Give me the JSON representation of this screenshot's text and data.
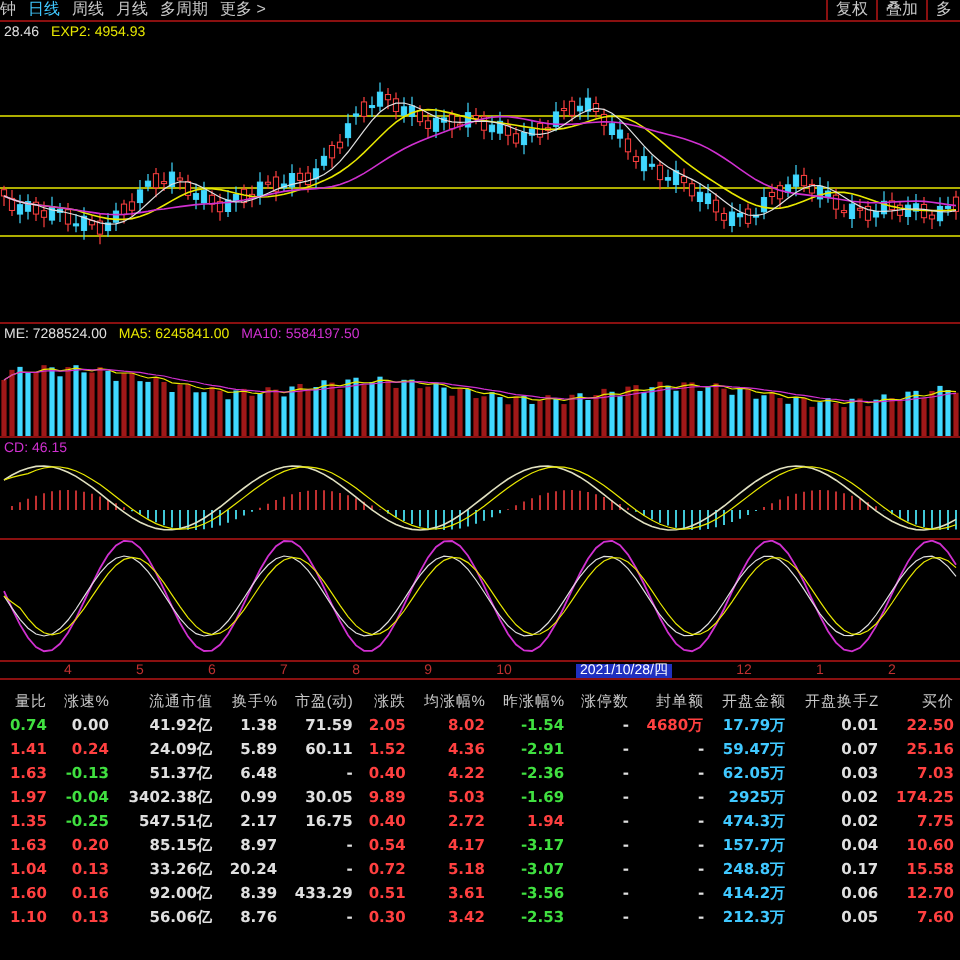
{
  "toolbar": {
    "periods": [
      {
        "label": "钟",
        "selected": false
      },
      {
        "label": "日线",
        "selected": true
      },
      {
        "label": "周线",
        "selected": false
      },
      {
        "label": "月线",
        "selected": false
      },
      {
        "label": "多周期",
        "selected": false
      },
      {
        "label": "更多 >",
        "selected": false
      }
    ],
    "actions": [
      "复权",
      "叠加",
      "多"
    ]
  },
  "main_legend": [
    {
      "text": "28.46",
      "color": "#e0e0e0"
    },
    {
      "text": "EXP2: 4954.93",
      "color": "#e8e800"
    }
  ],
  "volume_legend": [
    {
      "text": "ME: 7288524.00",
      "color": "#e0e0e0"
    },
    {
      "text": "MA5: 6245841.00",
      "color": "#e8e800"
    },
    {
      "text": "MA10: 5584197.50",
      "color": "#d030d0"
    }
  ],
  "macd_legend": [
    {
      "text": "CD: 46.15",
      "color": "#d030d0"
    }
  ],
  "axis_labels": [
    {
      "label": "4",
      "selected": false
    },
    {
      "label": "5",
      "selected": false
    },
    {
      "label": "6",
      "selected": false
    },
    {
      "label": "7",
      "selected": false
    },
    {
      "label": "8",
      "selected": false
    },
    {
      "label": "9",
      "selected": false
    },
    {
      "label": "10",
      "selected": false
    },
    {
      "label": "2021/10/28/四",
      "selected": true
    },
    {
      "label": "12",
      "selected": false
    },
    {
      "label": "1",
      "selected": false
    },
    {
      "label": "2",
      "selected": false
    }
  ],
  "table": {
    "columns": [
      "量比",
      "涨速%",
      "流通市值",
      "换手%",
      "市盈(动)",
      "涨跌",
      "均涨幅%",
      "昨涨幅%",
      "涨停数",
      "封单额",
      "开盘金额",
      "开盘换手Z",
      "买价"
    ],
    "rows": [
      {
        "cells": [
          {
            "text": "0.74",
            "color": "#40e040"
          },
          {
            "text": "0.00",
            "color": "#e0e0e0"
          },
          {
            "text": "41.92亿",
            "color": "#e0e0e0"
          },
          {
            "text": "1.38",
            "color": "#e0e0e0"
          },
          {
            "text": "71.59",
            "color": "#e0e0e0"
          },
          {
            "text": "2.05",
            "color": "#ff4040"
          },
          {
            "text": "8.02",
            "color": "#ff4040"
          },
          {
            "text": "-1.54",
            "color": "#40e040"
          },
          {
            "text": "-",
            "color": "#e0e0e0"
          },
          {
            "text": "4680万",
            "color": "#ff4040"
          },
          {
            "text": "17.79万",
            "color": "#40c8ff"
          },
          {
            "text": "0.01",
            "color": "#e0e0e0"
          },
          {
            "text": "22.50",
            "color": "#ff4040"
          }
        ]
      },
      {
        "cells": [
          {
            "text": "1.41",
            "color": "#ff4040"
          },
          {
            "text": "0.24",
            "color": "#ff4040"
          },
          {
            "text": "24.09亿",
            "color": "#e0e0e0"
          },
          {
            "text": "5.89",
            "color": "#e0e0e0"
          },
          {
            "text": "60.11",
            "color": "#e0e0e0"
          },
          {
            "text": "1.52",
            "color": "#ff4040"
          },
          {
            "text": "4.36",
            "color": "#ff4040"
          },
          {
            "text": "-2.91",
            "color": "#40e040"
          },
          {
            "text": "-",
            "color": "#e0e0e0"
          },
          {
            "text": "-",
            "color": "#e0e0e0"
          },
          {
            "text": "59.47万",
            "color": "#40c8ff"
          },
          {
            "text": "0.07",
            "color": "#e0e0e0"
          },
          {
            "text": "25.16",
            "color": "#ff4040"
          }
        ]
      },
      {
        "cells": [
          {
            "text": "1.63",
            "color": "#ff4040"
          },
          {
            "text": "-0.13",
            "color": "#40e040"
          },
          {
            "text": "51.37亿",
            "color": "#e0e0e0"
          },
          {
            "text": "6.48",
            "color": "#e0e0e0"
          },
          {
            "text": "-",
            "color": "#e0e0e0"
          },
          {
            "text": "0.40",
            "color": "#ff4040"
          },
          {
            "text": "4.22",
            "color": "#ff4040"
          },
          {
            "text": "-2.36",
            "color": "#40e040"
          },
          {
            "text": "-",
            "color": "#e0e0e0"
          },
          {
            "text": "-",
            "color": "#e0e0e0"
          },
          {
            "text": "62.05万",
            "color": "#40c8ff"
          },
          {
            "text": "0.03",
            "color": "#e0e0e0"
          },
          {
            "text": "7.03",
            "color": "#ff4040"
          }
        ]
      },
      {
        "cells": [
          {
            "text": "1.97",
            "color": "#ff4040"
          },
          {
            "text": "-0.04",
            "color": "#40e040"
          },
          {
            "text": "3402.38亿",
            "color": "#e0e0e0"
          },
          {
            "text": "0.99",
            "color": "#e0e0e0"
          },
          {
            "text": "30.05",
            "color": "#e0e0e0"
          },
          {
            "text": "9.89",
            "color": "#ff4040"
          },
          {
            "text": "5.03",
            "color": "#ff4040"
          },
          {
            "text": "-1.69",
            "color": "#40e040"
          },
          {
            "text": "-",
            "color": "#e0e0e0"
          },
          {
            "text": "-",
            "color": "#e0e0e0"
          },
          {
            "text": "2925万",
            "color": "#40c8ff"
          },
          {
            "text": "0.02",
            "color": "#e0e0e0"
          },
          {
            "text": "174.25",
            "color": "#ff4040"
          }
        ]
      },
      {
        "cells": [
          {
            "text": "1.35",
            "color": "#ff4040"
          },
          {
            "text": "-0.25",
            "color": "#40e040"
          },
          {
            "text": "547.51亿",
            "color": "#e0e0e0"
          },
          {
            "text": "2.17",
            "color": "#e0e0e0"
          },
          {
            "text": "16.75",
            "color": "#e0e0e0"
          },
          {
            "text": "0.40",
            "color": "#ff4040"
          },
          {
            "text": "2.72",
            "color": "#ff4040"
          },
          {
            "text": "1.94",
            "color": "#ff4040"
          },
          {
            "text": "-",
            "color": "#e0e0e0"
          },
          {
            "text": "-",
            "color": "#e0e0e0"
          },
          {
            "text": "474.3万",
            "color": "#40c8ff"
          },
          {
            "text": "0.02",
            "color": "#e0e0e0"
          },
          {
            "text": "7.75",
            "color": "#ff4040"
          }
        ]
      },
      {
        "cells": [
          {
            "text": "1.63",
            "color": "#ff4040"
          },
          {
            "text": "0.20",
            "color": "#ff4040"
          },
          {
            "text": "85.15亿",
            "color": "#e0e0e0"
          },
          {
            "text": "8.97",
            "color": "#e0e0e0"
          },
          {
            "text": "-",
            "color": "#e0e0e0"
          },
          {
            "text": "0.54",
            "color": "#ff4040"
          },
          {
            "text": "4.17",
            "color": "#ff4040"
          },
          {
            "text": "-3.17",
            "color": "#40e040"
          },
          {
            "text": "-",
            "color": "#e0e0e0"
          },
          {
            "text": "-",
            "color": "#e0e0e0"
          },
          {
            "text": "157.7万",
            "color": "#40c8ff"
          },
          {
            "text": "0.04",
            "color": "#e0e0e0"
          },
          {
            "text": "10.60",
            "color": "#ff4040"
          }
        ]
      },
      {
        "cells": [
          {
            "text": "1.04",
            "color": "#ff4040"
          },
          {
            "text": "0.13",
            "color": "#ff4040"
          },
          {
            "text": "33.26亿",
            "color": "#e0e0e0"
          },
          {
            "text": "20.24",
            "color": "#e0e0e0"
          },
          {
            "text": "-",
            "color": "#e0e0e0"
          },
          {
            "text": "0.72",
            "color": "#ff4040"
          },
          {
            "text": "5.18",
            "color": "#ff4040"
          },
          {
            "text": "-3.07",
            "color": "#40e040"
          },
          {
            "text": "-",
            "color": "#e0e0e0"
          },
          {
            "text": "-",
            "color": "#e0e0e0"
          },
          {
            "text": "248.8万",
            "color": "#40c8ff"
          },
          {
            "text": "0.17",
            "color": "#e0e0e0"
          },
          {
            "text": "15.58",
            "color": "#ff4040"
          }
        ]
      },
      {
        "cells": [
          {
            "text": "1.60",
            "color": "#ff4040"
          },
          {
            "text": "0.16",
            "color": "#ff4040"
          },
          {
            "text": "92.00亿",
            "color": "#e0e0e0"
          },
          {
            "text": "8.39",
            "color": "#e0e0e0"
          },
          {
            "text": "433.29",
            "color": "#e0e0e0"
          },
          {
            "text": "0.51",
            "color": "#ff4040"
          },
          {
            "text": "3.61",
            "color": "#ff4040"
          },
          {
            "text": "-3.56",
            "color": "#40e040"
          },
          {
            "text": "-",
            "color": "#e0e0e0"
          },
          {
            "text": "-",
            "color": "#e0e0e0"
          },
          {
            "text": "414.2万",
            "color": "#40c8ff"
          },
          {
            "text": "0.06",
            "color": "#e0e0e0"
          },
          {
            "text": "12.70",
            "color": "#ff4040"
          }
        ]
      },
      {
        "cells": [
          {
            "text": "1.10",
            "color": "#ff4040"
          },
          {
            "text": "0.13",
            "color": "#ff4040"
          },
          {
            "text": "56.06亿",
            "color": "#e0e0e0"
          },
          {
            "text": "8.76",
            "color": "#e0e0e0"
          },
          {
            "text": "-",
            "color": "#e0e0e0"
          },
          {
            "text": "0.30",
            "color": "#ff4040"
          },
          {
            "text": "3.42",
            "color": "#ff4040"
          },
          {
            "text": "-2.53",
            "color": "#40e040"
          },
          {
            "text": "-",
            "color": "#e0e0e0"
          },
          {
            "text": "-",
            "color": "#e0e0e0"
          },
          {
            "text": "212.3万",
            "color": "#40c8ff"
          },
          {
            "text": "0.05",
            "color": "#e0e0e0"
          },
          {
            "text": "7.60",
            "color": "#ff4040"
          }
        ]
      }
    ]
  }
}
